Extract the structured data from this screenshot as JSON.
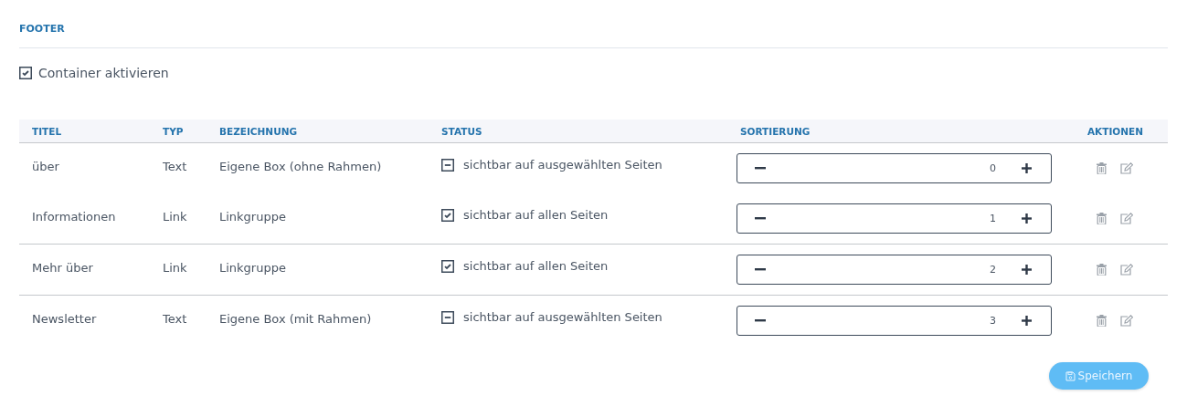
{
  "section_title": "FOOTER",
  "container_toggle": {
    "label": "Container aktivieren",
    "checked": true
  },
  "table": {
    "columns": [
      "TITEL",
      "TYP",
      "BEZEICHNUNG",
      "STATUS",
      "SORTIERUNG",
      "AKTIONEN"
    ],
    "rows": [
      {
        "title": "über",
        "type": "Text",
        "name": "Eigene Box (ohne Rahmen)",
        "status": "sichtbar auf ausgewählten Seiten",
        "all_pages": false,
        "sort": "0"
      },
      {
        "title": "Informationen",
        "type": "Link",
        "name": "Linkgruppe",
        "status": "sichtbar auf allen Seiten",
        "all_pages": true,
        "sort": "1"
      },
      {
        "title": "Mehr über",
        "type": "Link",
        "name": "Linkgruppe",
        "status": "sichtbar auf allen Seiten",
        "all_pages": true,
        "sort": "2"
      },
      {
        "title": "Newsletter",
        "type": "Text",
        "name": "Eigene Box (mit Rahmen)",
        "status": "sichtbar auf ausgewählten Seiten",
        "all_pages": false,
        "sort": "3"
      }
    ]
  },
  "save_button": "Speichern"
}
